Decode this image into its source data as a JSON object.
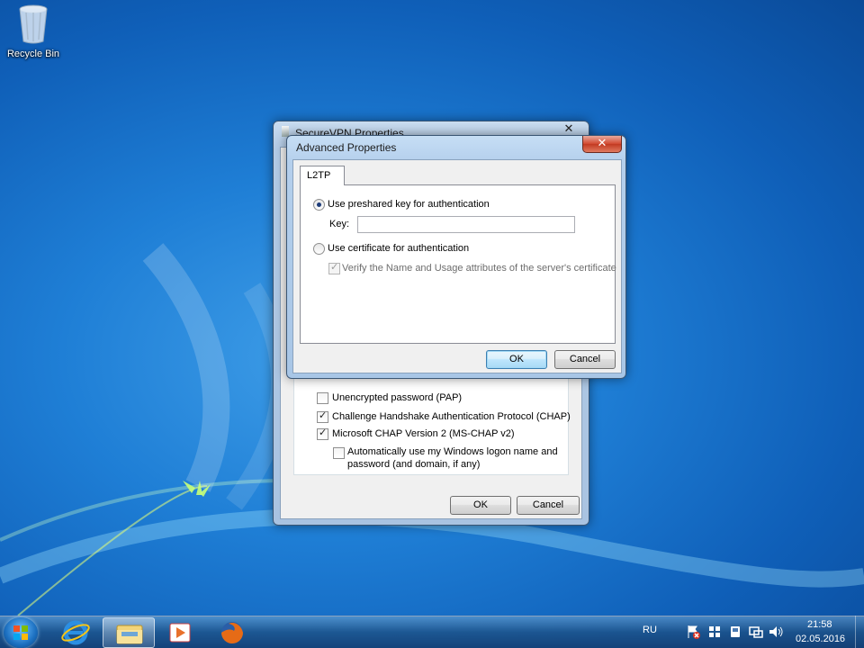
{
  "desktop": {
    "recycle_bin_label": "Recycle Bin"
  },
  "back_window": {
    "title": "SecureVPN Properties",
    "close_label": "✕",
    "checkboxes": [
      {
        "label": "Unencrypted password (PAP)",
        "checked": false
      },
      {
        "label": "Challenge Handshake Authentication Protocol (CHAP)",
        "checked": true
      },
      {
        "label": "Microsoft CHAP Version 2 (MS-CHAP v2)",
        "checked": true
      }
    ],
    "auto_logon_line1": "Automatically use my Windows logon name and",
    "auto_logon_line2": "password (and domain, if any)",
    "ok_label": "OK",
    "cancel_label": "Cancel"
  },
  "dialog": {
    "title": "Advanced Properties",
    "close_label": "✕",
    "tab_label": "L2TP",
    "preshared_label": "Use preshared key for authentication",
    "key_label": "Key:",
    "key_value": "",
    "certificate_label": "Use certificate for authentication",
    "verify_label": "Verify the Name and Usage attributes of the server's certificate",
    "ok_label": "OK",
    "cancel_label": "Cancel"
  },
  "taskbar": {
    "language": "RU",
    "time": "21:58",
    "date": "02.05.2016"
  },
  "check_mark": "✓"
}
